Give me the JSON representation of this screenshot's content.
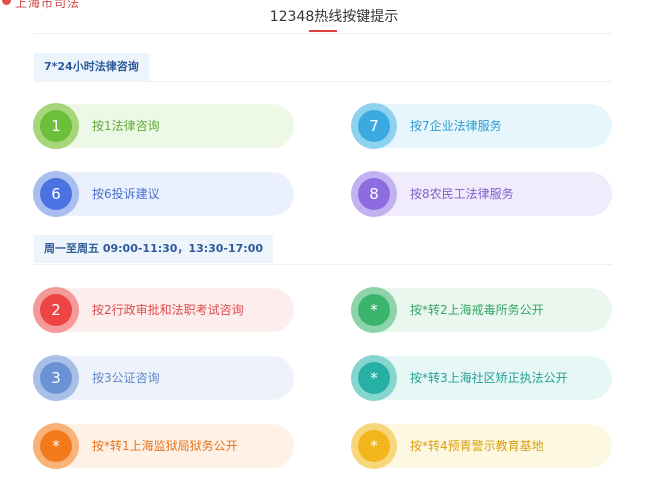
{
  "page": {
    "corner_text": "上海市司法",
    "title": "12348热线按键提示"
  },
  "sections": [
    {
      "label": "7*24小时法律咨询",
      "items": [
        {
          "key": "1",
          "label": "按1法律咨询",
          "ring": "#a7d67a",
          "fill": "#6cbf3b",
          "bg": "#eef8e6",
          "text": "#62a83a"
        },
        {
          "key": "7",
          "label": "按7企业法律服务",
          "ring": "#8fd2f0",
          "fill": "#3aaae0",
          "bg": "#e6f6fc",
          "text": "#2f9bcc"
        },
        {
          "key": "6",
          "label": "按6投诉建议",
          "ring": "#a8bdf0",
          "fill": "#4a72e0",
          "bg": "#eaf0fc",
          "text": "#4a6fcf"
        },
        {
          "key": "8",
          "label": "按8农民工法律服务",
          "ring": "#c3b2f2",
          "fill": "#8c6ce0",
          "bg": "#f1ecfc",
          "text": "#7d5dcc"
        }
      ]
    },
    {
      "label": "周一至周五 09:00-11:30，13:30-17:00",
      "items": [
        {
          "key": "2",
          "label": "按2行政审批和法职考试咨询",
          "ring": "#f59a9a",
          "fill": "#ef4444",
          "bg": "#fdeeee",
          "text": "#e04a4a"
        },
        {
          "key": "*",
          "label": "按*转2上海戒毒所务公开",
          "ring": "#8ed3aa",
          "fill": "#3bb46e",
          "bg": "#eaf7ef",
          "text": "#35a565"
        },
        {
          "key": "3",
          "label": "按3公证咨询",
          "ring": "#a9c0e6",
          "fill": "#6a92d4",
          "bg": "#eef3fb",
          "text": "#5f87c8"
        },
        {
          "key": "*",
          "label": "按*转3上海社区矫正执法公开",
          "ring": "#86d6d0",
          "fill": "#27b0a5",
          "bg": "#e6f7f5",
          "text": "#23a096"
        },
        {
          "key": "*",
          "label": "按*转1上海监狱局狱务公开",
          "ring": "#f8b37a",
          "fill": "#f27a1a",
          "bg": "#fef1e6",
          "text": "#e8731b"
        },
        {
          "key": "*",
          "label": "按*转4预青警示教育基地",
          "ring": "#f8d77c",
          "fill": "#f2b51c",
          "bg": "#fdf8e2",
          "text": "#d9a010"
        }
      ]
    }
  ]
}
